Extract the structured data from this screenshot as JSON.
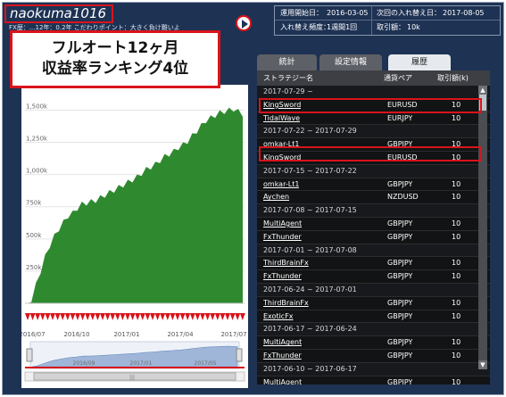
{
  "header": {
    "username": "naokuma1016",
    "fx_experience": "FX歴：...12年：0.2年",
    "point": "こだわりポイント：大きく負け難いよ"
  },
  "info": {
    "start_label": "運用開始日：",
    "start_value": "2016-03-05",
    "next_label": "次回の入れ替え日：",
    "next_value": "2017-08-05",
    "freq_label": "入れ替え頻度：",
    "freq_value": "1週間1回",
    "lot_label": "取引額：",
    "lot_value": "10k"
  },
  "callout": {
    "line1": "フルオート12ヶ月",
    "line2": "収益率ランキング4位"
  },
  "tabs": [
    "統計",
    "設定情報",
    "履歴"
  ],
  "table": {
    "headers": [
      "ストラテジー名",
      "通貨ペア",
      "取引額(k)"
    ],
    "rows": [
      {
        "kind": "week",
        "label": "2017-07-29 ~"
      },
      {
        "kind": "data",
        "name": "KingSword",
        "pair": "EURUSD",
        "lot": "10"
      },
      {
        "kind": "data",
        "name": "TidalWave",
        "pair": "EURJPY",
        "lot": "10"
      },
      {
        "kind": "week",
        "label": "2017-07-22 ~ 2017-07-29"
      },
      {
        "kind": "data",
        "name": "omkar-Lt1",
        "pair": "GBPJPY",
        "lot": "10"
      },
      {
        "kind": "data",
        "name": "KingSword",
        "pair": "EURUSD",
        "lot": "10"
      },
      {
        "kind": "week",
        "label": "2017-07-15 ~ 2017-07-22"
      },
      {
        "kind": "data",
        "name": "omkar-Lt1",
        "pair": "GBPJPY",
        "lot": "10"
      },
      {
        "kind": "data",
        "name": "Aychen",
        "pair": "NZDUSD",
        "lot": "10"
      },
      {
        "kind": "week",
        "label": "2017-07-08 ~ 2017-07-15"
      },
      {
        "kind": "data",
        "name": "MultiAgent",
        "pair": "GBPJPY",
        "lot": "10"
      },
      {
        "kind": "data",
        "name": "FxThunder",
        "pair": "GBPJPY",
        "lot": "10"
      },
      {
        "kind": "week",
        "label": "2017-07-01 ~ 2017-07-08"
      },
      {
        "kind": "data",
        "name": "ThirdBrainFx",
        "pair": "GBPJPY",
        "lot": "10"
      },
      {
        "kind": "data",
        "name": "FxThunder",
        "pair": "GBPJPY",
        "lot": "10"
      },
      {
        "kind": "week",
        "label": "2017-06-24 ~ 2017-07-01"
      },
      {
        "kind": "data",
        "name": "ThirdBrainFx",
        "pair": "GBPJPY",
        "lot": "10"
      },
      {
        "kind": "data",
        "name": "ExoticFx",
        "pair": "GBPJPY",
        "lot": "10"
      },
      {
        "kind": "week",
        "label": "2017-06-17 ~ 2017-06-24"
      },
      {
        "kind": "data",
        "name": "MultiAgent",
        "pair": "GBPJPY",
        "lot": "10"
      },
      {
        "kind": "data",
        "name": "FxThunder",
        "pair": "GBPJPY",
        "lot": "10"
      },
      {
        "kind": "week",
        "label": "2017-06-10 ~ 2017-06-17"
      },
      {
        "kind": "data",
        "name": "MultiAgent",
        "pair": "GBPJPY",
        "lot": "10"
      }
    ]
  },
  "chart_data": {
    "type": "area",
    "y_ticks": [
      "1,500k",
      "1,250k",
      "1,000k",
      "750k",
      "500k",
      "250k"
    ],
    "y_tick_values": [
      1500,
      1250,
      1000,
      750,
      500,
      250
    ],
    "ylim": [
      0,
      1600
    ],
    "x_ticks": [
      "2016/07",
      "2016/10",
      "2017/01",
      "2017/04",
      "2017/07"
    ],
    "navigator_ticks": [
      "2016/09",
      "2017/01",
      "2017/05"
    ],
    "series": [
      {
        "values": [
          0,
          50,
          160,
          270,
          380,
          470,
          540,
          600,
          650,
          700,
          720,
          760,
          790,
          800,
          810,
          820,
          840,
          860,
          880,
          900,
          920,
          940,
          960,
          980,
          1000,
          1030,
          1060,
          1080,
          1100,
          1130,
          1160,
          1180,
          1200,
          1230,
          1250,
          1280,
          1320,
          1360,
          1400,
          1440,
          1460,
          1480,
          1500,
          1510,
          1520,
          1530,
          1510,
          1490
        ]
      }
    ],
    "colors": {
      "area": "#2f8a2f",
      "area_top": "#1f6e1f",
      "markers": "#d9141b"
    },
    "grid": true
  },
  "colors": {
    "background": "#1e3253",
    "highlight": "#d9141b",
    "table_bg": "#121314"
  }
}
